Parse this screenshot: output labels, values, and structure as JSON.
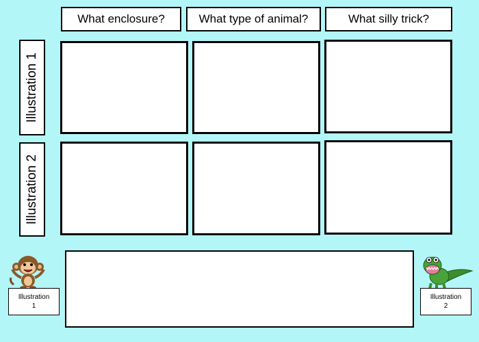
{
  "headers": [
    "What enclosure?",
    "What type of animal?",
    "What silly trick?"
  ],
  "rows": [
    "Illustration 1",
    "Illustration 2"
  ],
  "bottom_labels": {
    "left_line1": "Illustration",
    "left_line2": "1",
    "right_line1": "Illustration",
    "right_line2": "2"
  },
  "icons": {
    "left": "monkey-icon",
    "right": "crocodile-icon"
  }
}
